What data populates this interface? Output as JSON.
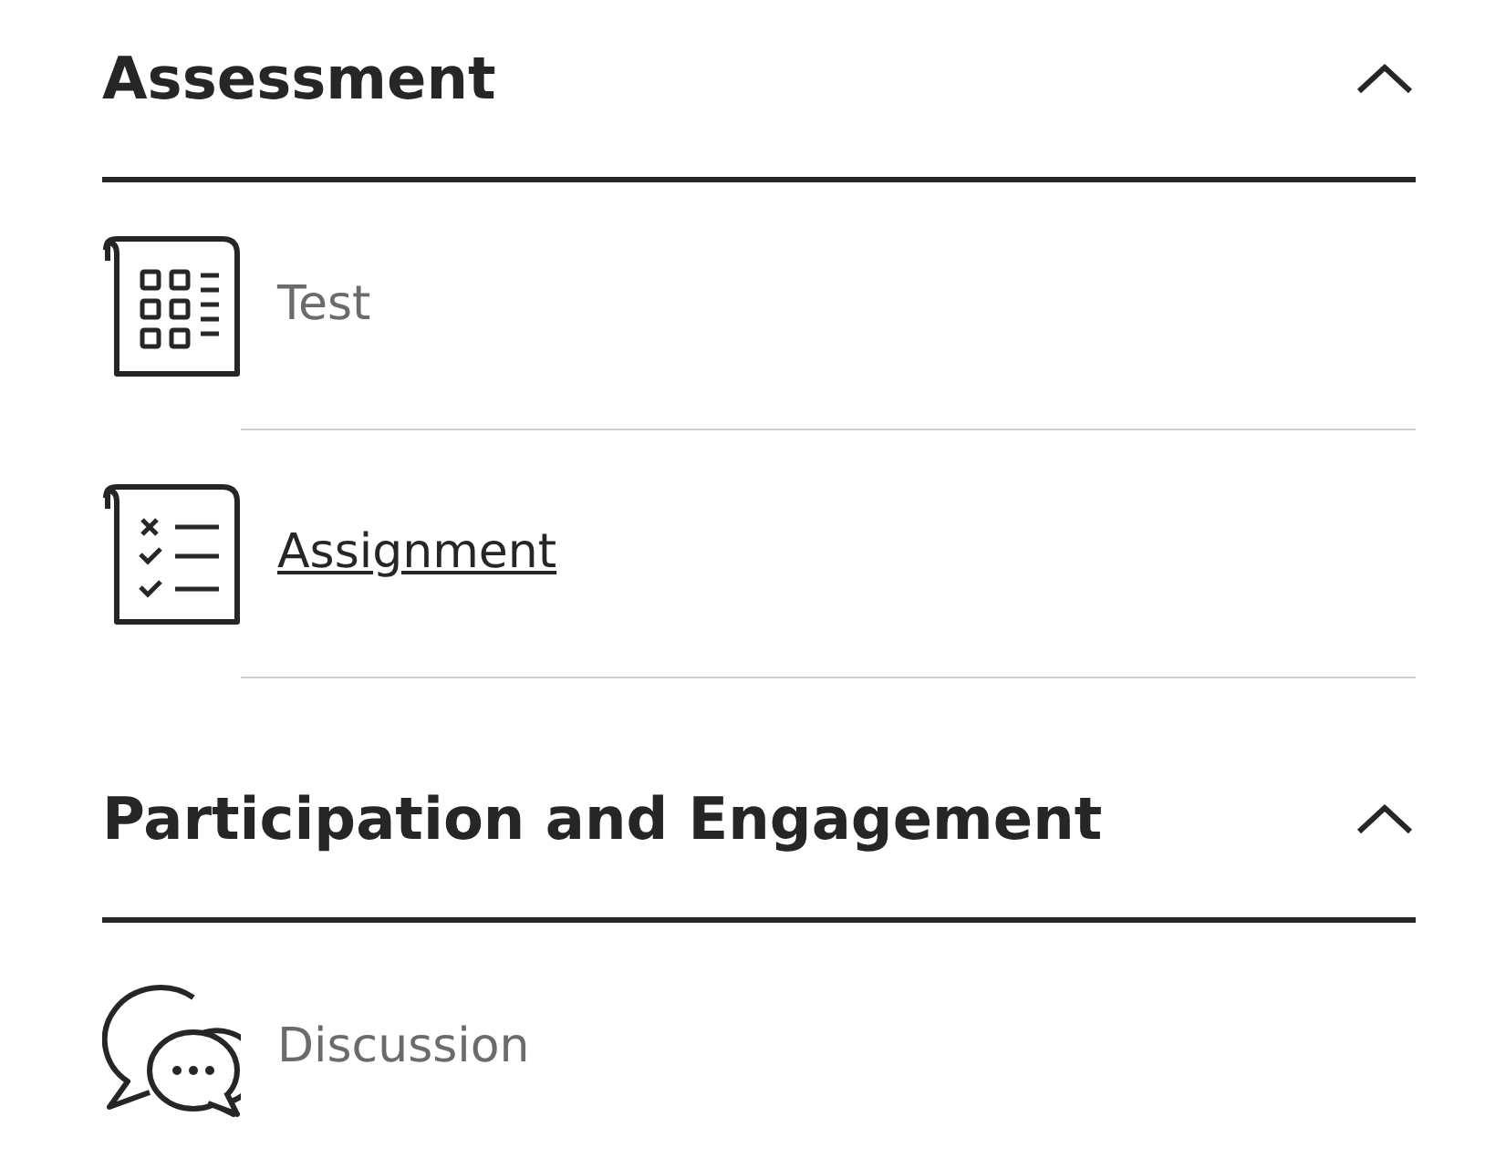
{
  "sections": [
    {
      "title": "Assessment",
      "expanded": true,
      "items": [
        {
          "kind": "test",
          "label": "Test",
          "highlighted": false
        },
        {
          "kind": "assignment",
          "label": "Assignment",
          "highlighted": true
        }
      ]
    },
    {
      "title": "Participation and Engagement",
      "expanded": true,
      "items": [
        {
          "kind": "discussion",
          "label": "Discussion",
          "highlighted": false
        }
      ]
    }
  ]
}
